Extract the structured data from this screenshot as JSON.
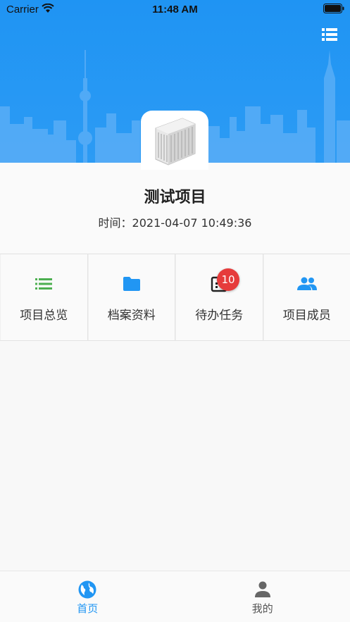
{
  "status_bar": {
    "carrier": "Carrier",
    "time": "11:48 AM"
  },
  "project": {
    "title": "测试项目",
    "time_label": "时间：",
    "time_value": "2021-04-07 10:49:36"
  },
  "grid": {
    "items": [
      {
        "label": "项目总览",
        "icon": "list-icon",
        "color": "#4caf50"
      },
      {
        "label": "档案资料",
        "icon": "folder-icon",
        "color": "#2196f3"
      },
      {
        "label": "待办任务",
        "icon": "task-icon",
        "color": "#222222",
        "badge": "10"
      },
      {
        "label": "项目成员",
        "icon": "people-icon",
        "color": "#2196f3"
      }
    ]
  },
  "tabbar": {
    "items": [
      {
        "label": "首页",
        "icon": "globe-icon",
        "active": true
      },
      {
        "label": "我的",
        "icon": "person-icon",
        "active": false
      }
    ]
  },
  "colors": {
    "header_blue": "#1f94f3",
    "active_tab": "#2196f3",
    "inactive_tab": "#666666",
    "badge_red": "#e63b3b"
  }
}
